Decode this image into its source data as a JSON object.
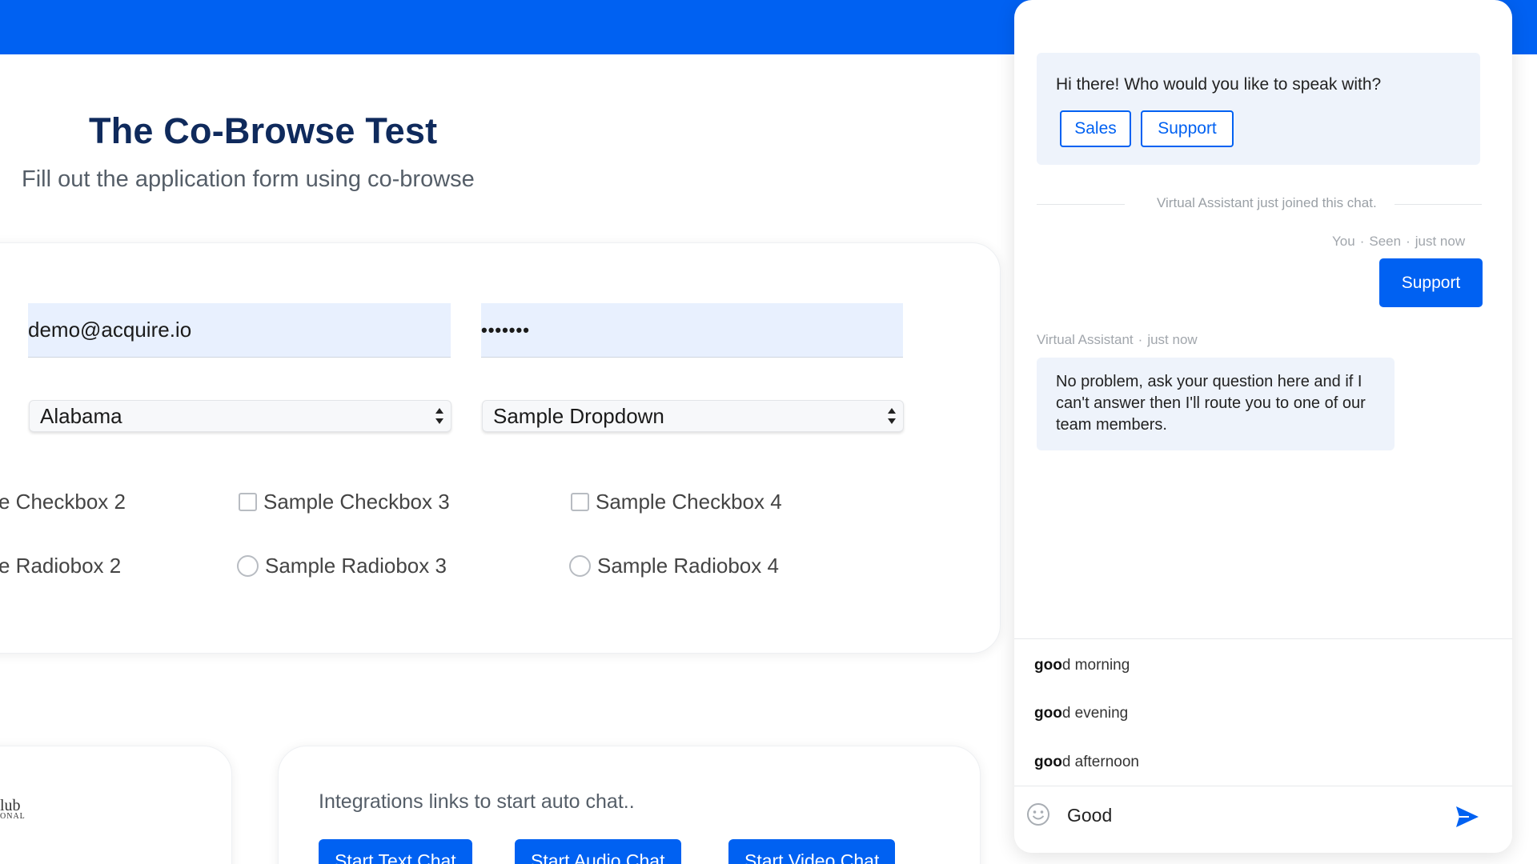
{
  "page": {
    "title": "The Co-Browse Test",
    "subtitle": "Fill out the application form using co-browse"
  },
  "form": {
    "email_value": "demo@acquire.io",
    "password_value": "•••••••",
    "state_selected": "Alabama",
    "dropdown_selected": "Sample Dropdown",
    "checkboxes": [
      {
        "label": "e Checkbox 2",
        "checked": false
      },
      {
        "label": "Sample Checkbox 3",
        "checked": false
      },
      {
        "label": "Sample Checkbox 4",
        "checked": false
      }
    ],
    "radios": [
      {
        "label": "e Radiobox 2",
        "checked": false
      },
      {
        "label": "Sample Radiobox 3",
        "checked": false
      },
      {
        "label": "Sample Radiobox 4",
        "checked": false
      }
    ]
  },
  "logo": {
    "line1": "lub",
    "line2": "ONAL"
  },
  "integrations": {
    "heading": "Integrations links to start auto chat..",
    "buttons": [
      "Start Text Chat",
      "Start Audio Chat",
      "Start Video Chat"
    ]
  },
  "chat": {
    "greeting": "Hi there! Who would you like to speak with?",
    "quick_replies": [
      "Sales",
      "Support"
    ],
    "system_message": "Virtual Assistant just joined this chat.",
    "user_meta": {
      "sender": "You",
      "status": "Seen",
      "time": "just now"
    },
    "user_message": "Support",
    "bot_meta": {
      "sender": "Virtual Assistant",
      "time": "just now"
    },
    "bot_message": "No problem, ask your question here and if I can't answer then I'll route you to one of our team members.",
    "suggestions": [
      {
        "match": "goo",
        "rest": "d morning"
      },
      {
        "match": "goo",
        "rest": "d evening"
      },
      {
        "match": "goo",
        "rest": "d afternoon"
      }
    ],
    "composer_value": "Good",
    "accent_color": "#0061f2"
  }
}
